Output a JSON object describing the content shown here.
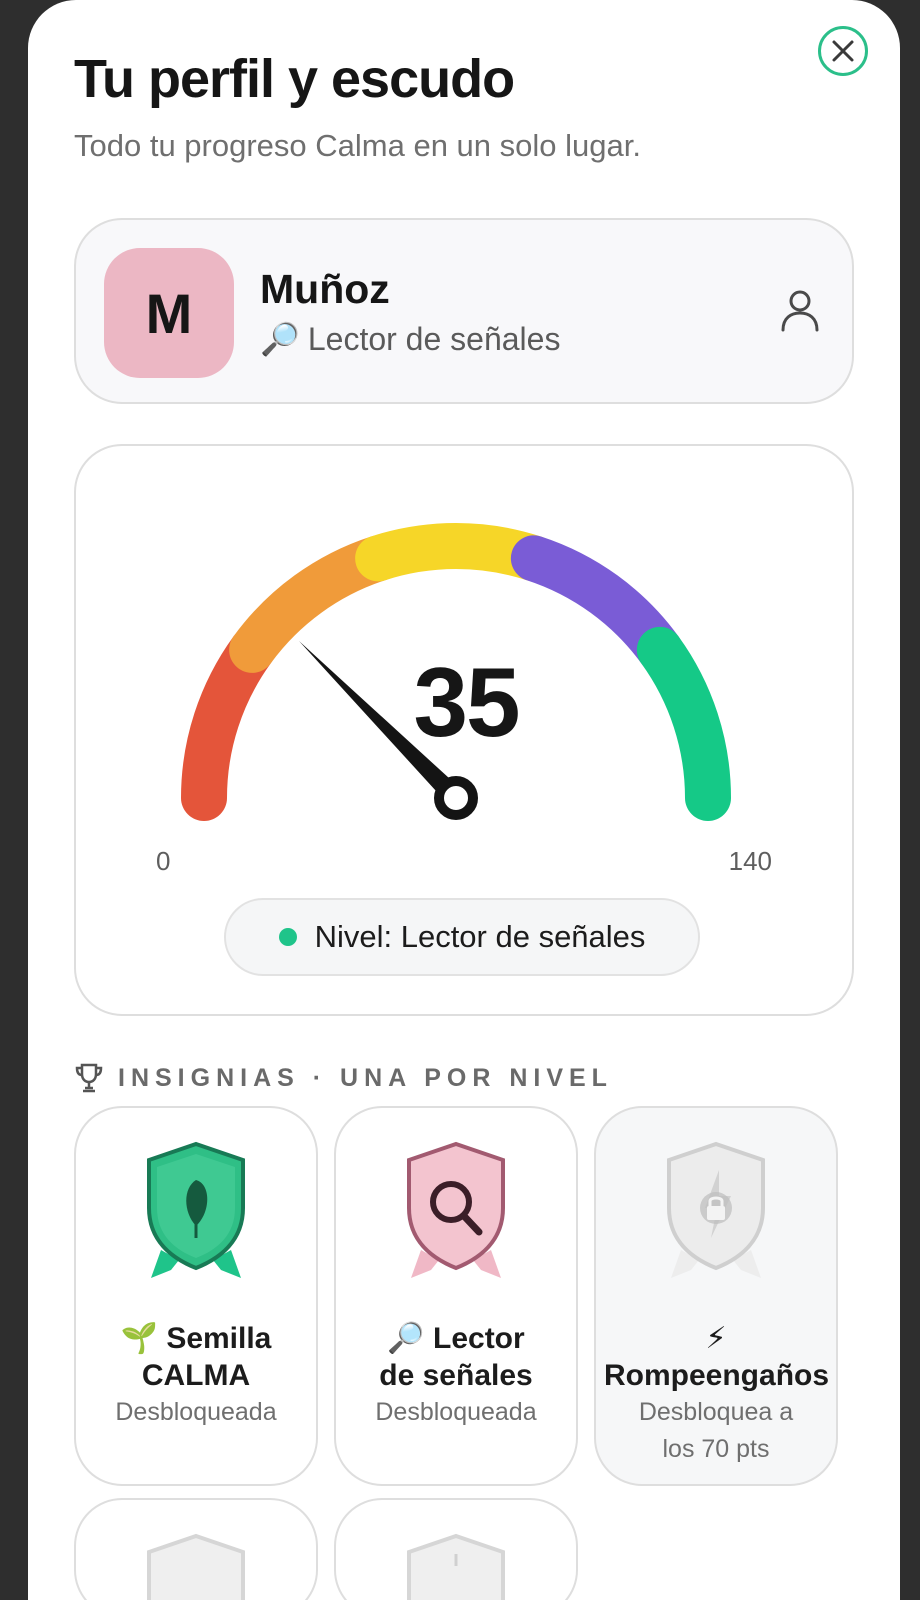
{
  "header": {
    "title": "Tu perfil y escudo",
    "subtitle": "Todo tu progreso Calma en un solo lugar."
  },
  "profile": {
    "initial": "M",
    "name": "Muñoz",
    "role_emoji": "🔎",
    "role": "Lector de señales"
  },
  "gauge": {
    "score": "35",
    "min_label": "0",
    "max_label": "140",
    "value": 35,
    "max": 140,
    "segment_colors": [
      "#e4553a",
      "#f09b3a",
      "#f6d628",
      "#7a5cd6",
      "#15c987"
    ],
    "level_text": "Nivel: Lector de señales"
  },
  "badges_section": {
    "label": "INSIGNIAS · UNA POR NIVEL"
  },
  "badges": [
    {
      "emoji": "🌱",
      "name_line1": "Semilla",
      "name_line2": "CALMA",
      "status": "Desbloqueada",
      "locked": false,
      "icon": "leaf-shield-icon"
    },
    {
      "emoji": "🔎",
      "name_line1": "Lector",
      "name_line2": "de señales",
      "status": "Desbloqueada",
      "locked": false,
      "icon": "magnifier-shield-icon"
    },
    {
      "emoji": "⚡",
      "name_line1": "",
      "name_line2": "Rompeengaños",
      "status_line1": "Desbloquea a",
      "status_line2": "los 70 pts",
      "locked": true,
      "icon": "locked-shield-icon"
    }
  ]
}
